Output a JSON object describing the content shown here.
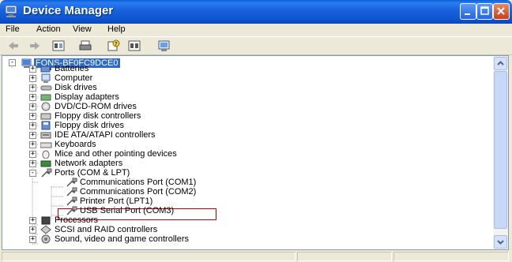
{
  "window": {
    "title": "Device Manager"
  },
  "menu": [
    "File",
    "Action",
    "View",
    "Help"
  ],
  "toolbar": [
    {
      "icon": "back-arrow-icon"
    },
    {
      "icon": "forward-arrow-icon"
    },
    {
      "icon": "show-hide-tree-icon"
    },
    {
      "icon": "print-icon"
    },
    {
      "icon": "help-icon"
    },
    {
      "icon": "properties-icon"
    },
    {
      "icon": "scan-hardware-icon"
    }
  ],
  "tree": {
    "root": "FONS-BF0FC9DCE0",
    "items": [
      {
        "label": "Batteries",
        "icon": "battery-icon",
        "expander": "+"
      },
      {
        "label": "Computer",
        "icon": "computer-icon",
        "expander": "+"
      },
      {
        "label": "Disk drives",
        "icon": "disk-drive-icon",
        "expander": "+"
      },
      {
        "label": "Display adapters",
        "icon": "display-adapter-icon",
        "expander": "+"
      },
      {
        "label": "DVD/CD-ROM drives",
        "icon": "dvd-drive-icon",
        "expander": "+"
      },
      {
        "label": "Floppy disk controllers",
        "icon": "floppy-controller-icon",
        "expander": "+"
      },
      {
        "label": "Floppy disk drives",
        "icon": "floppy-drive-icon",
        "expander": "+"
      },
      {
        "label": "IDE ATA/ATAPI controllers",
        "icon": "ide-controller-icon",
        "expander": "+"
      },
      {
        "label": "Keyboards",
        "icon": "keyboard-icon",
        "expander": "+"
      },
      {
        "label": "Mice and other pointing devices",
        "icon": "mouse-icon",
        "expander": "+"
      },
      {
        "label": "Network adapters",
        "icon": "network-adapter-icon",
        "expander": "+"
      },
      {
        "label": "Ports (COM & LPT)",
        "icon": "port-icon",
        "expander": "-"
      },
      {
        "label": "Communications Port (COM1)",
        "icon": "port-icon",
        "child": true
      },
      {
        "label": "Communications Port (COM2)",
        "icon": "port-icon",
        "child": true
      },
      {
        "label": "Printer Port (LPT1)",
        "icon": "port-icon",
        "child": true
      },
      {
        "label": "USB Serial Port (COM3)",
        "icon": "port-icon",
        "child": true,
        "highlighted": true
      },
      {
        "label": "Processors",
        "icon": "processor-icon",
        "expander": "+"
      },
      {
        "label": "SCSI and RAID controllers",
        "icon": "scsi-controller-icon",
        "expander": "+"
      },
      {
        "label": "Sound, video and game controllers",
        "icon": "sound-icon",
        "expander": "+"
      }
    ]
  },
  "colors": {
    "titlebar": "#0f55cf",
    "selection": "#316ac5",
    "highlight_border": "#c00000"
  }
}
